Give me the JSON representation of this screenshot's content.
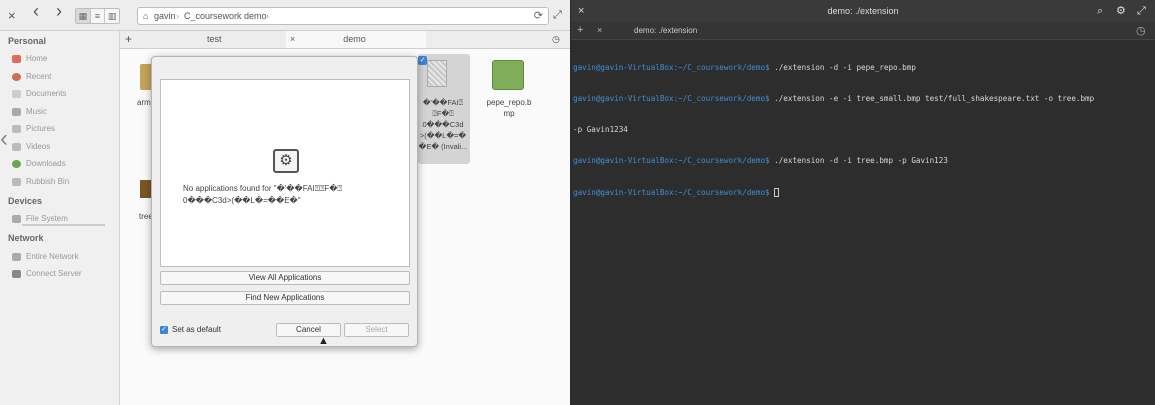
{
  "file_manager": {
    "toolbar": {
      "close_glyph": "×",
      "back_glyph": "‹",
      "forward_glyph": "›",
      "reload_glyph": "⟳",
      "fullscreen_glyph": "⤢",
      "view_icon_glyph": "▦",
      "view_list_glyph": "≡",
      "view_column_glyph": "▥",
      "breadcrumbs": [
        "gavin",
        "C_coursework",
        "demo"
      ]
    },
    "sidebar": {
      "personal_header": "Personal",
      "personal_items": [
        "Home",
        "Recent",
        "Documents",
        "Music",
        "Pictures",
        "Videos",
        "Downloads",
        "Rubbish Bin"
      ],
      "devices_header": "Devices",
      "device_items": [
        "File System"
      ],
      "network_header": "Network",
      "network_items": [
        "Entire Network",
        "Connect Server"
      ]
    },
    "tabs": {
      "new_tab_glyph": "+",
      "tab_close_glyph": "×",
      "history_glyph": "◷",
      "items": [
        "test",
        "demo"
      ]
    },
    "files": {
      "arm_label": "arm",
      "tree_label": "tree",
      "garbled_lines": [
        "�'��FAI⍰",
        "⍰F�⍰",
        "0���C3d",
        ">(��L�=�",
        "�E� (Invali..."
      ],
      "pepe_lines": [
        "pepe_repo.b",
        "mp"
      ]
    }
  },
  "dialog": {
    "message_lines": [
      "No applications found for \"�'��FAI⍰⍰F�⍰",
      "0���C3d>(��L�=��E�\""
    ],
    "view_all_label": "View All Applications",
    "find_new_label": "Find New Applications",
    "set_default_label": "Set as default",
    "set_default_checked": true,
    "cancel_label": "Cancel",
    "select_label": "Select"
  },
  "terminal": {
    "title": "demo: ./extension",
    "tab_label": "demo: ./extension",
    "close_glyph": "×",
    "search_glyph": "⌕",
    "settings_glyph": "⚙",
    "fullscreen_glyph": "⤢",
    "add_tab_glyph": "+",
    "history_glyph": "◷",
    "lines": [
      {
        "prompt": "gavin@gavin-VirtualBox:~/C_coursework/demo$",
        "cmd": " ./extension -d -i pepe_repo.bmp"
      },
      {
        "prompt": "gavin@gavin-VirtualBox:~/C_coursework/demo$",
        "cmd": " ./extension -e -i tree_small.bmp test/full_shakespeare.txt -o tree.bmp"
      },
      {
        "prompt": "",
        "cmd": "-p Gavin1234"
      },
      {
        "prompt": "gavin@gavin-VirtualBox:~/C_coursework/demo$",
        "cmd": " ./extension -d -i tree.bmp -p Gavin123"
      },
      {
        "prompt": "gavin@gavin-VirtualBox:~/C_coursework/demo$",
        "cmd": " "
      }
    ]
  }
}
